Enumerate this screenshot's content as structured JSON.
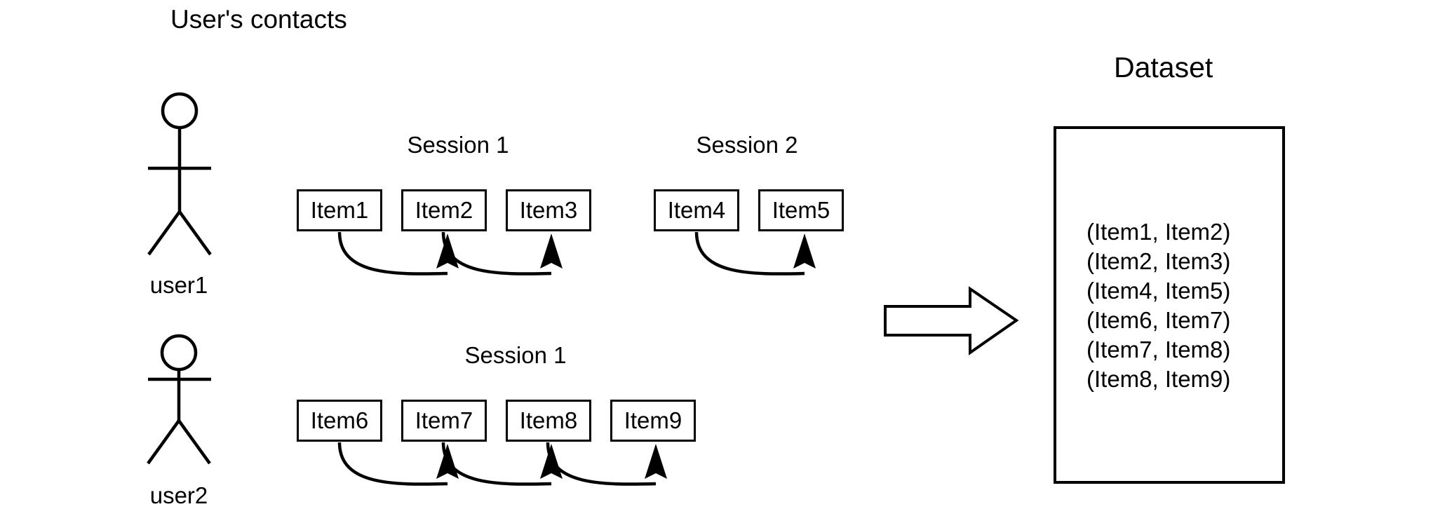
{
  "diagram": {
    "title": "User's contacts",
    "dataset_title": "Dataset"
  },
  "users": [
    {
      "label": "user1",
      "icon": "stick-figure-person-icon",
      "sessions": [
        {
          "label": "Session 1",
          "items": [
            "Item1",
            "Item2",
            "Item3"
          ]
        },
        {
          "label": "Session 2",
          "items": [
            "Item4",
            "Item5"
          ]
        }
      ]
    },
    {
      "label": "user2",
      "icon": "stick-figure-person-icon",
      "sessions": [
        {
          "label": "Session 1",
          "items": [
            "Item6",
            "Item7",
            "Item8",
            "Item9"
          ]
        }
      ]
    }
  ],
  "transform_arrow": {
    "icon": "block-arrow-right-icon",
    "direction": "right"
  },
  "dataset": {
    "pairs": [
      "(Item1, Item2)",
      "(Item2, Item3)",
      "(Item4, Item5)",
      "(Item6, Item7)",
      "(Item7, Item8)",
      "(Item8, Item9)"
    ]
  },
  "colors": {
    "stroke": "#000000",
    "background": "#ffffff"
  }
}
